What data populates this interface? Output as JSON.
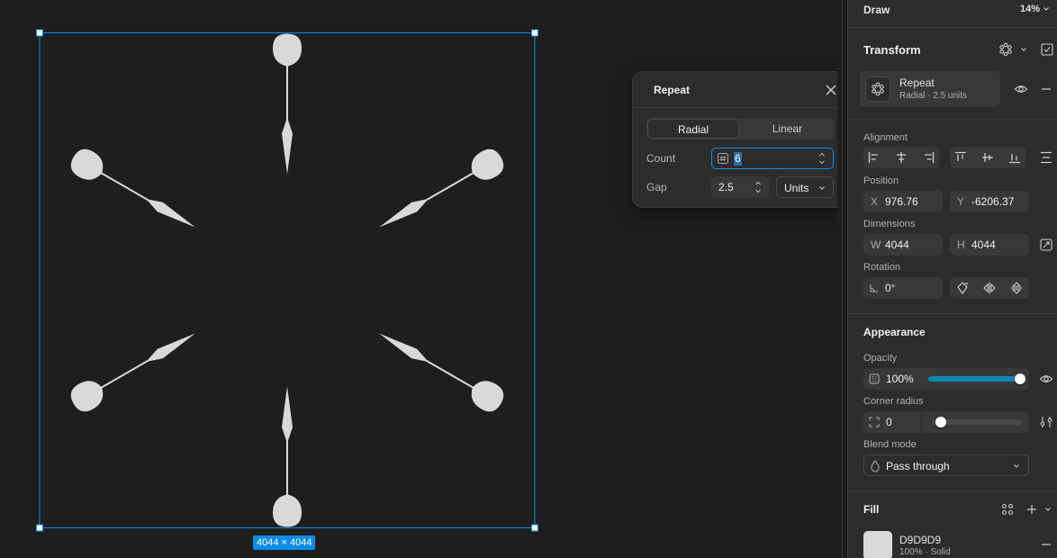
{
  "canvas": {
    "dimensions_badge": "4044 × 4044",
    "shape_color": "#d9d9d9",
    "selection_color": "#0c8ce9"
  },
  "repeat_popover": {
    "title": "Repeat",
    "tabs": [
      "Radial",
      "Linear"
    ],
    "active_tab": "Radial",
    "count_label": "Count",
    "count_value": "6",
    "gap_label": "Gap",
    "gap_value": "2.5",
    "units_value": "Units"
  },
  "panel": {
    "draw_label": "Draw",
    "zoom": "14%",
    "transform_title": "Transform",
    "repeat_card": {
      "title": "Repeat",
      "subtitle": "Radial · 2.5 units"
    },
    "alignment_label": "Alignment",
    "position_label": "Position",
    "position": {
      "x_prefix": "X",
      "x": "976.76",
      "y_prefix": "Y",
      "y": "-6206.37"
    },
    "dimensions_label": "Dimensions",
    "dimensions": {
      "w_prefix": "W",
      "w": "4044",
      "h_prefix": "H",
      "h": "4044"
    },
    "rotation_label": "Rotation",
    "rotation": "0°",
    "appearance_title": "Appearance",
    "opacity_label": "Opacity",
    "opacity": "100%",
    "opacity_level": 1.0,
    "corner_radius_label": "Corner radius",
    "corner_radius": "0",
    "corner_radius_level": 0.0,
    "blend_mode_label": "Blend mode",
    "blend_mode": "Pass through",
    "fill_title": "Fill",
    "fill": {
      "hex": "D9D9D9",
      "detail": "100% · Solid"
    },
    "accent_color": "#0d99ff",
    "slider_fill_color": "#0c8ab0"
  }
}
